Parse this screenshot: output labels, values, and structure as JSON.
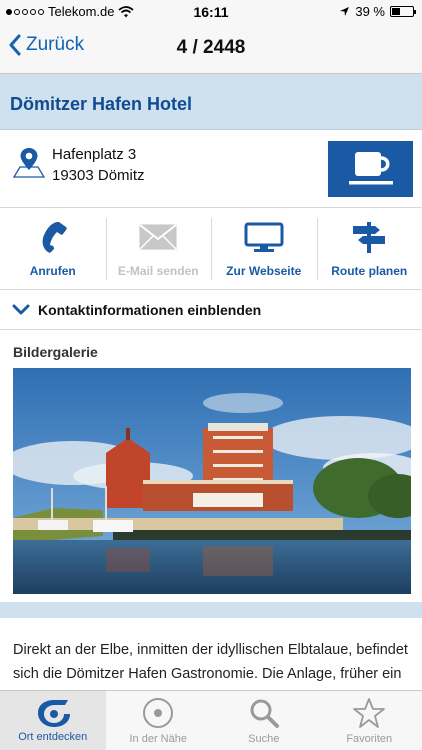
{
  "status_bar": {
    "carrier": "Telekom.de",
    "time": "16:11",
    "battery_percent": "39 %",
    "battery_level": 0.39
  },
  "nav": {
    "back_label": "Zurück",
    "title": "4 / 2448"
  },
  "hotel": {
    "name": "Dömitzer Hafen Hotel",
    "street": "Hafenplatz 3",
    "city": "19303 Dömitz",
    "category_icon": "coffee-cup-icon"
  },
  "actions": [
    {
      "label": "Anrufen",
      "icon": "phone-icon",
      "enabled": true
    },
    {
      "label": "E-Mail senden",
      "icon": "mail-icon",
      "enabled": false
    },
    {
      "label": "Zur Webseite",
      "icon": "monitor-icon",
      "enabled": true
    },
    {
      "label": "Route planen",
      "icon": "signpost-icon",
      "enabled": true
    }
  ],
  "contact": {
    "toggle_label": "Kontaktinformationen einblenden"
  },
  "gallery": {
    "heading": "Bildergalerie"
  },
  "description": "Direkt an der Elbe, inmitten der idyllischen Elbtalaue, befindet sich die Dömitzer Hafen Gastronomie. Die Anlage, früher ein Kornspeicher, liegt nahe dem Ortskern der Festungsstadt.",
  "tabs": [
    {
      "label": "Ort entdecken",
      "icon": "logo-icon",
      "active": true
    },
    {
      "label": "In der Nähe",
      "icon": "location-target-icon",
      "active": false
    },
    {
      "label": "Suche",
      "icon": "search-icon",
      "active": false
    },
    {
      "label": "Favoriten",
      "icon": "star-icon",
      "active": false
    }
  ],
  "colors": {
    "brand_blue": "#1a5aa5",
    "link_blue": "#1363b4",
    "title_band": "#cfe0ef",
    "disabled": "#c3c3c3"
  }
}
